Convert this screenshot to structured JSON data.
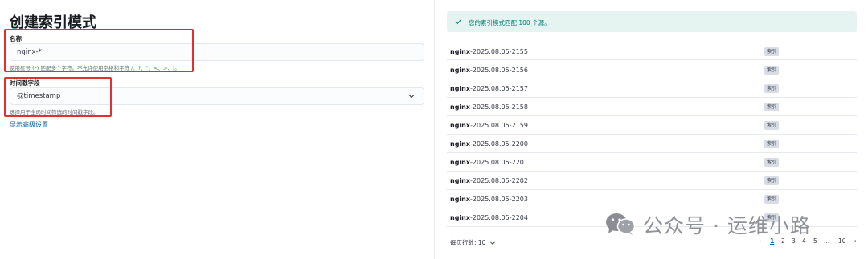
{
  "page": {
    "title": "创建索引模式"
  },
  "form": {
    "name_label": "名称",
    "name_value": "nginx-*",
    "name_help": "使用星号 (*) 匹配多个字符。不允许使用空格和字符 /、?、\"、<、>、|。",
    "timestamp_label": "时间戳字段",
    "timestamp_value": "@timestamp",
    "timestamp_help": "选择用于全局时间筛选的时间戳字段。",
    "advanced_link": "显示高级设置"
  },
  "callout": {
    "text": "您的索引模式匹配 100 个源。",
    "icon": "check-icon",
    "color": "#017d73"
  },
  "sources": [
    {
      "prefix": "nginx",
      "suffix": "-2025.08.05-2155",
      "badge": "索引"
    },
    {
      "prefix": "nginx",
      "suffix": "-2025.08.05-2156",
      "badge": "索引"
    },
    {
      "prefix": "nginx",
      "suffix": "-2025.08.05-2157",
      "badge": "索引"
    },
    {
      "prefix": "nginx",
      "suffix": "-2025.08.05-2158",
      "badge": "索引"
    },
    {
      "prefix": "nginx",
      "suffix": "-2025.08.05-2159",
      "badge": "索引"
    },
    {
      "prefix": "nginx",
      "suffix": "-2025.08.05-2200",
      "badge": "索引"
    },
    {
      "prefix": "nginx",
      "suffix": "-2025.08.05-2201",
      "badge": "索引"
    },
    {
      "prefix": "nginx",
      "suffix": "-2025.08.05-2202",
      "badge": "索引"
    },
    {
      "prefix": "nginx",
      "suffix": "-2025.08.05-2203",
      "badge": "索引"
    },
    {
      "prefix": "nginx",
      "suffix": "-2025.08.05-2204",
      "badge": "索引"
    }
  ],
  "pagination": {
    "rows_per_page_label": "每页行数: 10",
    "prev": "‹",
    "pages": [
      "1",
      "2",
      "3",
      "4",
      "5"
    ],
    "ellipsis": "...",
    "last": "10",
    "next": "›"
  },
  "watermark": {
    "text": "公众号 · 运维小路"
  },
  "colors": {
    "highlight": "#e2302e",
    "link": "#0061a6",
    "success_bg": "#e6f4f1"
  }
}
